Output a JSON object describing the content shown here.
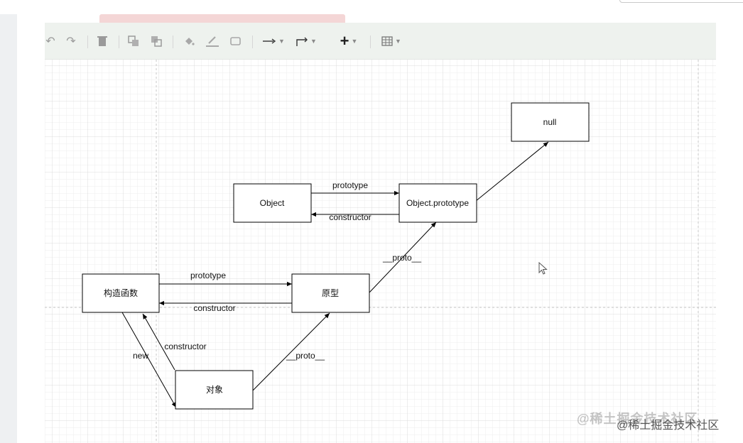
{
  "toolbar": {
    "icons": [
      "undo-icon",
      "redo-icon",
      "delete-icon",
      "to-front-icon",
      "to-back-icon",
      "fill-color-icon",
      "line-color-icon",
      "shadow-icon",
      "connection-icon",
      "waypoints-icon",
      "insert-icon",
      "table-icon"
    ]
  },
  "diagram": {
    "nodes": {
      "null": "null",
      "object": "Object",
      "object_prototype": "Object.prototype",
      "constructor_fn": "构造函数",
      "prototype": "原型",
      "instance": "对象"
    },
    "edges": {
      "object_prototype_label": "prototype",
      "object_constructor_label": "constructor",
      "proto_to_object_prototype": "__proto__",
      "fn_prototype_label": "prototype",
      "fn_constructor_label": "constructor",
      "new_label": "new",
      "instance_constructor_label": "constructor",
      "instance_proto_label": "__proto__"
    }
  },
  "watermark": {
    "back": "@稀土掘金技术社区",
    "front": "@稀土掘金技术社区"
  },
  "colors": {
    "grid": "#e6e6e6",
    "toolbar_bg": "#eef2ee",
    "stroke": "#000000"
  }
}
